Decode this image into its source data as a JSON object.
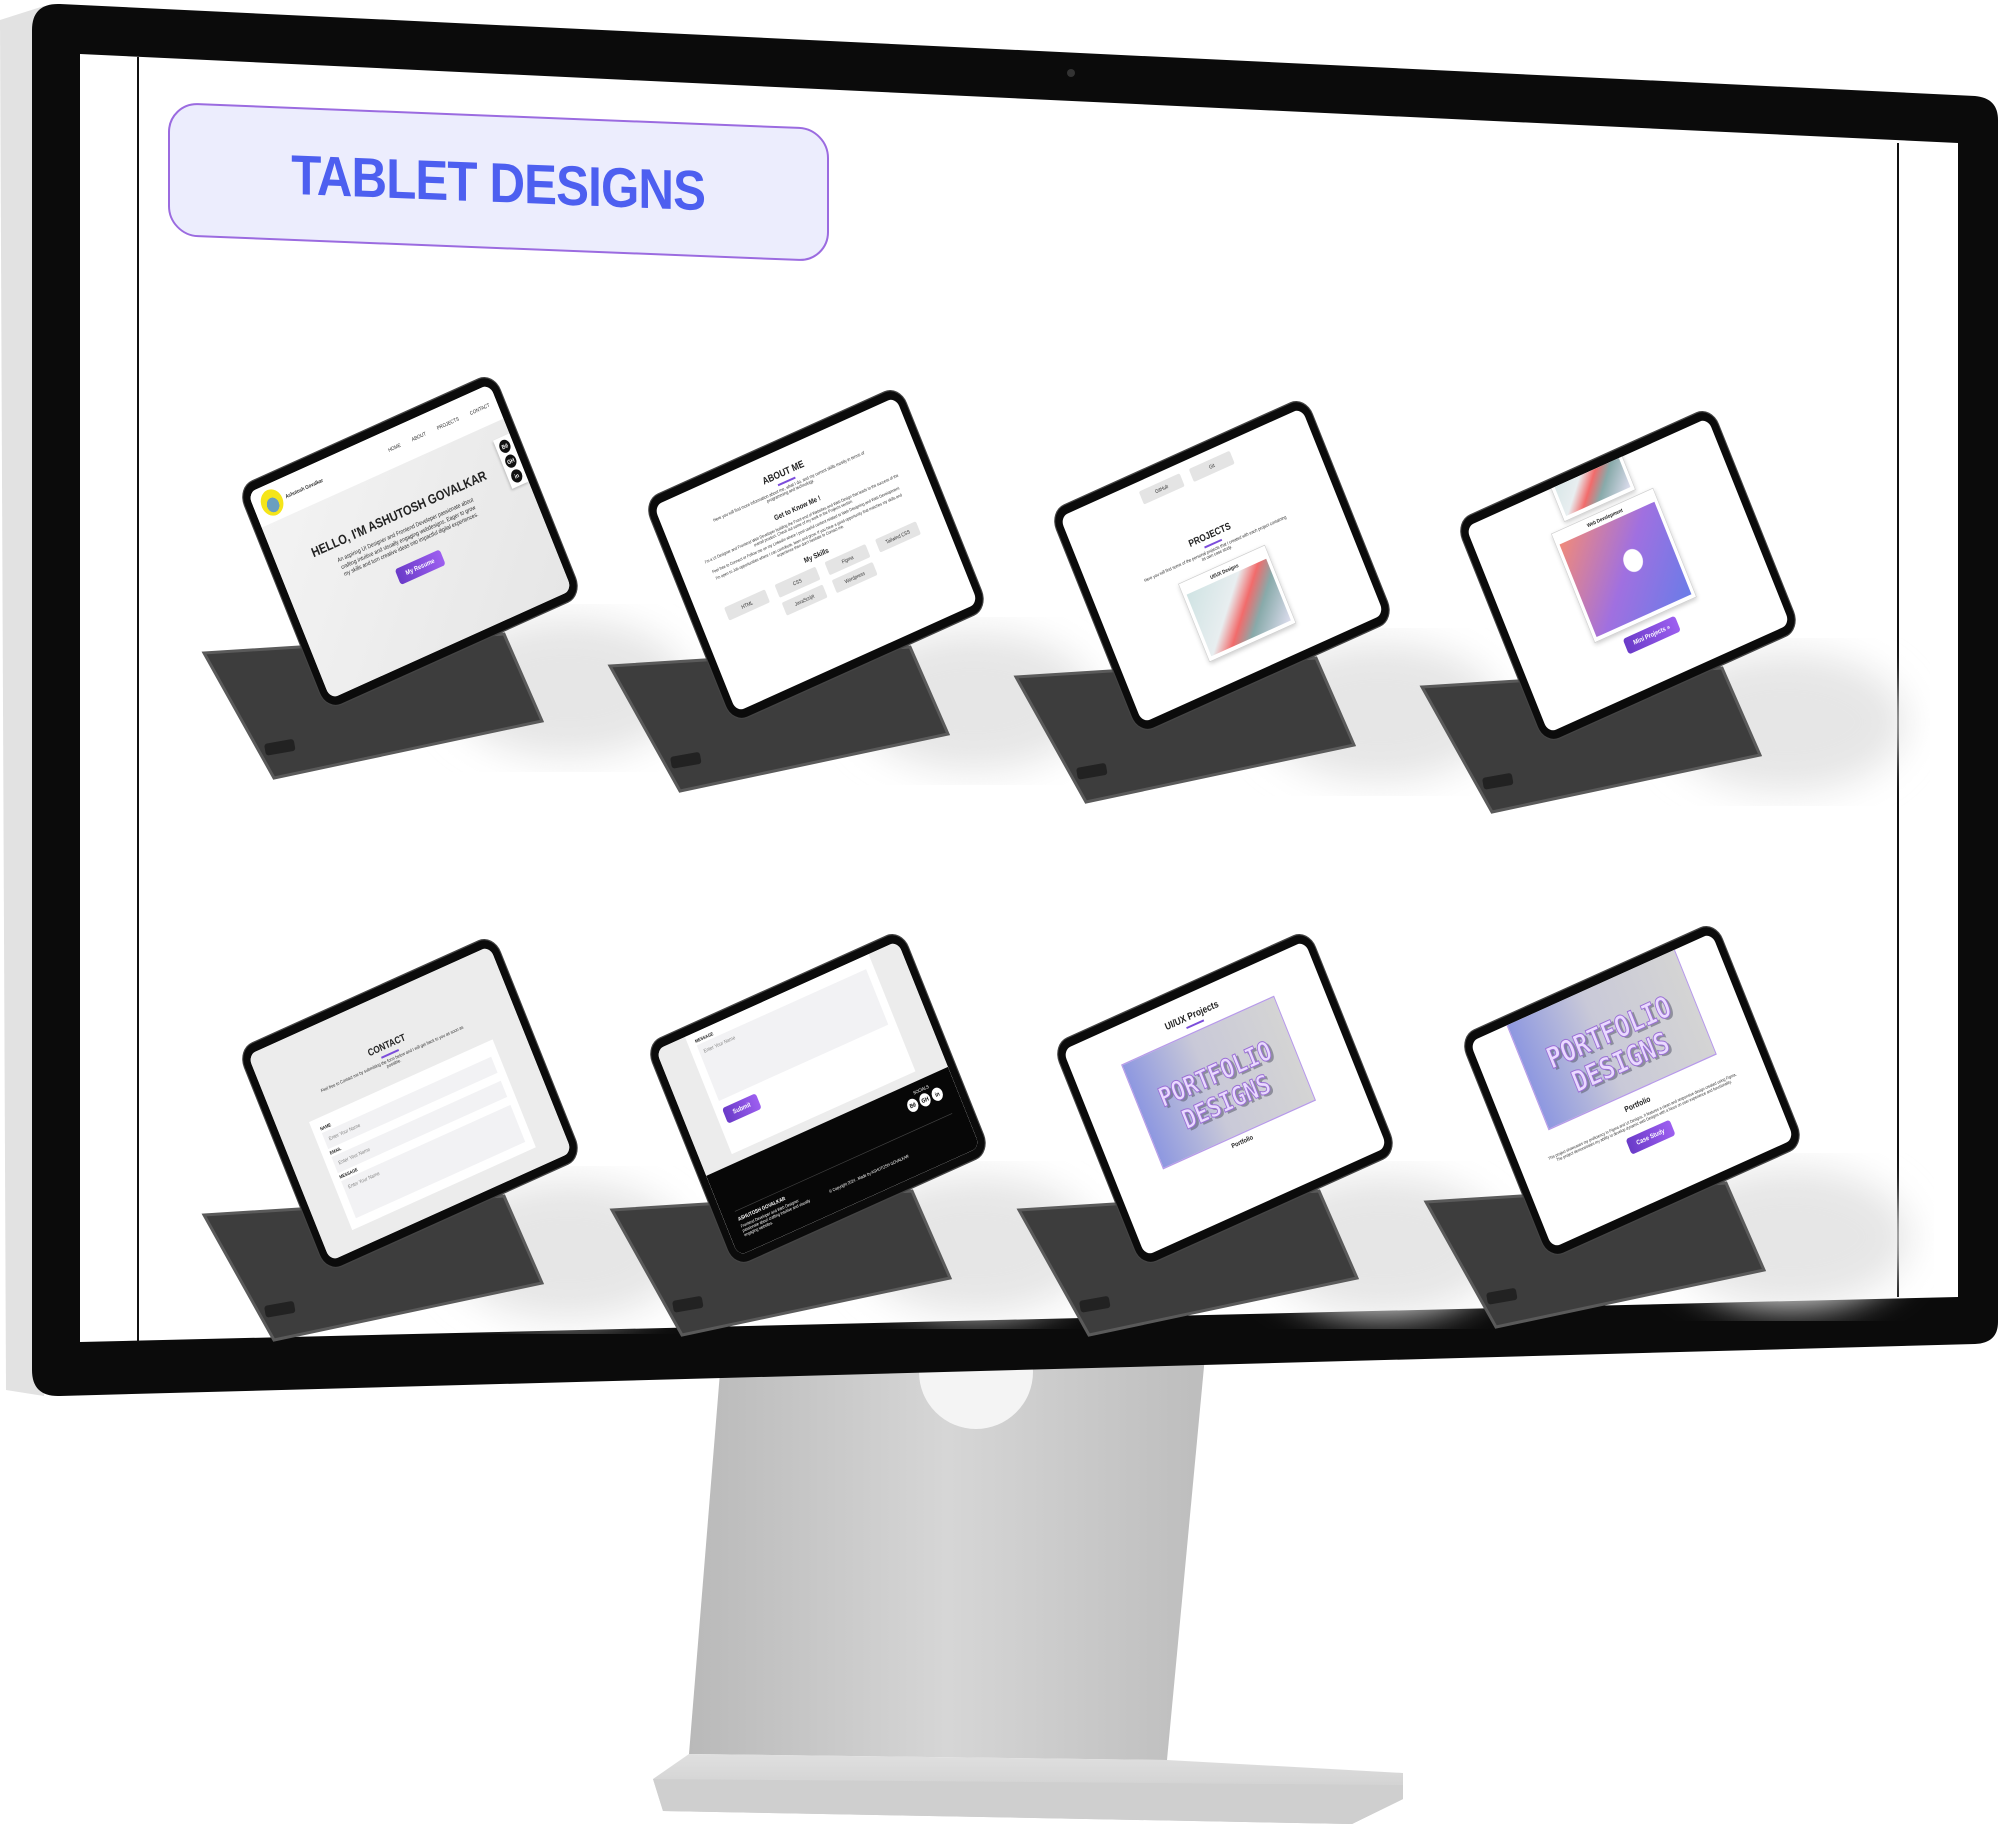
{
  "title": "TABLET DESIGNS",
  "colors": {
    "title_text": "#4d5ff0",
    "title_bg": "#ecedfd",
    "title_border": "#9b6be0",
    "accent": "#7c4ddb",
    "bezel": "#0b0b0b",
    "stand": "#c9c9c9"
  },
  "tablets": {
    "hero": {
      "brand": "Ashutosh Govalkar",
      "nav": [
        "HOME",
        "ABOUT",
        "PROJECTS",
        "CONTACT"
      ],
      "heading": "HELLO, I'M ASHUTOSH GOVALKAR",
      "text": "An aspiring UI Designer and Frontend Developer passionate about crafting intuitive and visually engaging webdesigns. Eager to grow my skills and turn creative ideas into impactful digital experiences.",
      "button": "My Resume",
      "socials": [
        "Bē",
        "GH",
        "in"
      ]
    },
    "about": {
      "heading": "ABOUT ME",
      "intro": "Here you will find more information about me, what I do, and my current skills mostly in terms of programming and technology.",
      "subheading": "Get to Know Me !",
      "p1": "I'm a UI Designer and Frontend Web Developer building the Front-end of Websites and Web Design that leads to the success of the overall product. Check out some of my work in the Projects section.",
      "p2": "Feel free to Connect or Follow me on my LinkedIn where I post useful content related to Web Designing and Web Development.",
      "p3": "I'm open to Job opportunities where I can contribute, learn and grow. If you have a good opportunity that matches my skills and experience then don't hesitate to Contact me.",
      "skills_heading": "My Skills",
      "skills": [
        "HTML",
        "CSS",
        "Figma",
        "Tailwind CSS",
        "JavaScript",
        "Wordpress"
      ]
    },
    "projects": {
      "pills": [
        "GitHub",
        "Git"
      ],
      "heading": "PROJECTS",
      "intro": "Here you will find some of the personal projects that I created with each project containing its own case study.",
      "card": "UI/UX Designs"
    },
    "web": {
      "card": "Web Development",
      "button": "Mini Projects »"
    },
    "contact": {
      "heading": "CONTACT",
      "intro": "Feel free to Contact me by submitting the form below and I will get back to you as soon as possible.",
      "labels": [
        "NAME",
        "EMAIL",
        "MESSAGE"
      ],
      "placeholder": "Enter Your Name"
    },
    "footer": {
      "label": "MESSAGE",
      "placeholder": "Enter Your Name",
      "button": "Submit",
      "socials_heading": "SOCIALS",
      "socials": [
        "Bē",
        "GH",
        "in"
      ],
      "name": "ASHUTOSH GOVALKAR",
      "desc": "Frontend Developer and Web Designer passionate about crafting intuitive and visually engaging websites.",
      "copyright": "© Copyright 2024 . Made by ASHUTOSH GOVALKAR"
    },
    "uiux": {
      "heading": "UI/UX Projects",
      "banner": [
        "PORTFOLIO",
        "DESIGNS"
      ],
      "caption": "Portfolio"
    },
    "portfolio": {
      "banner": [
        "PORTFOLIO",
        "DESIGNS"
      ],
      "heading": "Portfolio",
      "text": "This project showcases my proficiency in Figma and UI Designs. It features a clean and responsive design created using Figma. The project demonstrates my ability to develop dynamic web Designs with a focus on user experience and functionality.",
      "button": "Case Study"
    }
  }
}
